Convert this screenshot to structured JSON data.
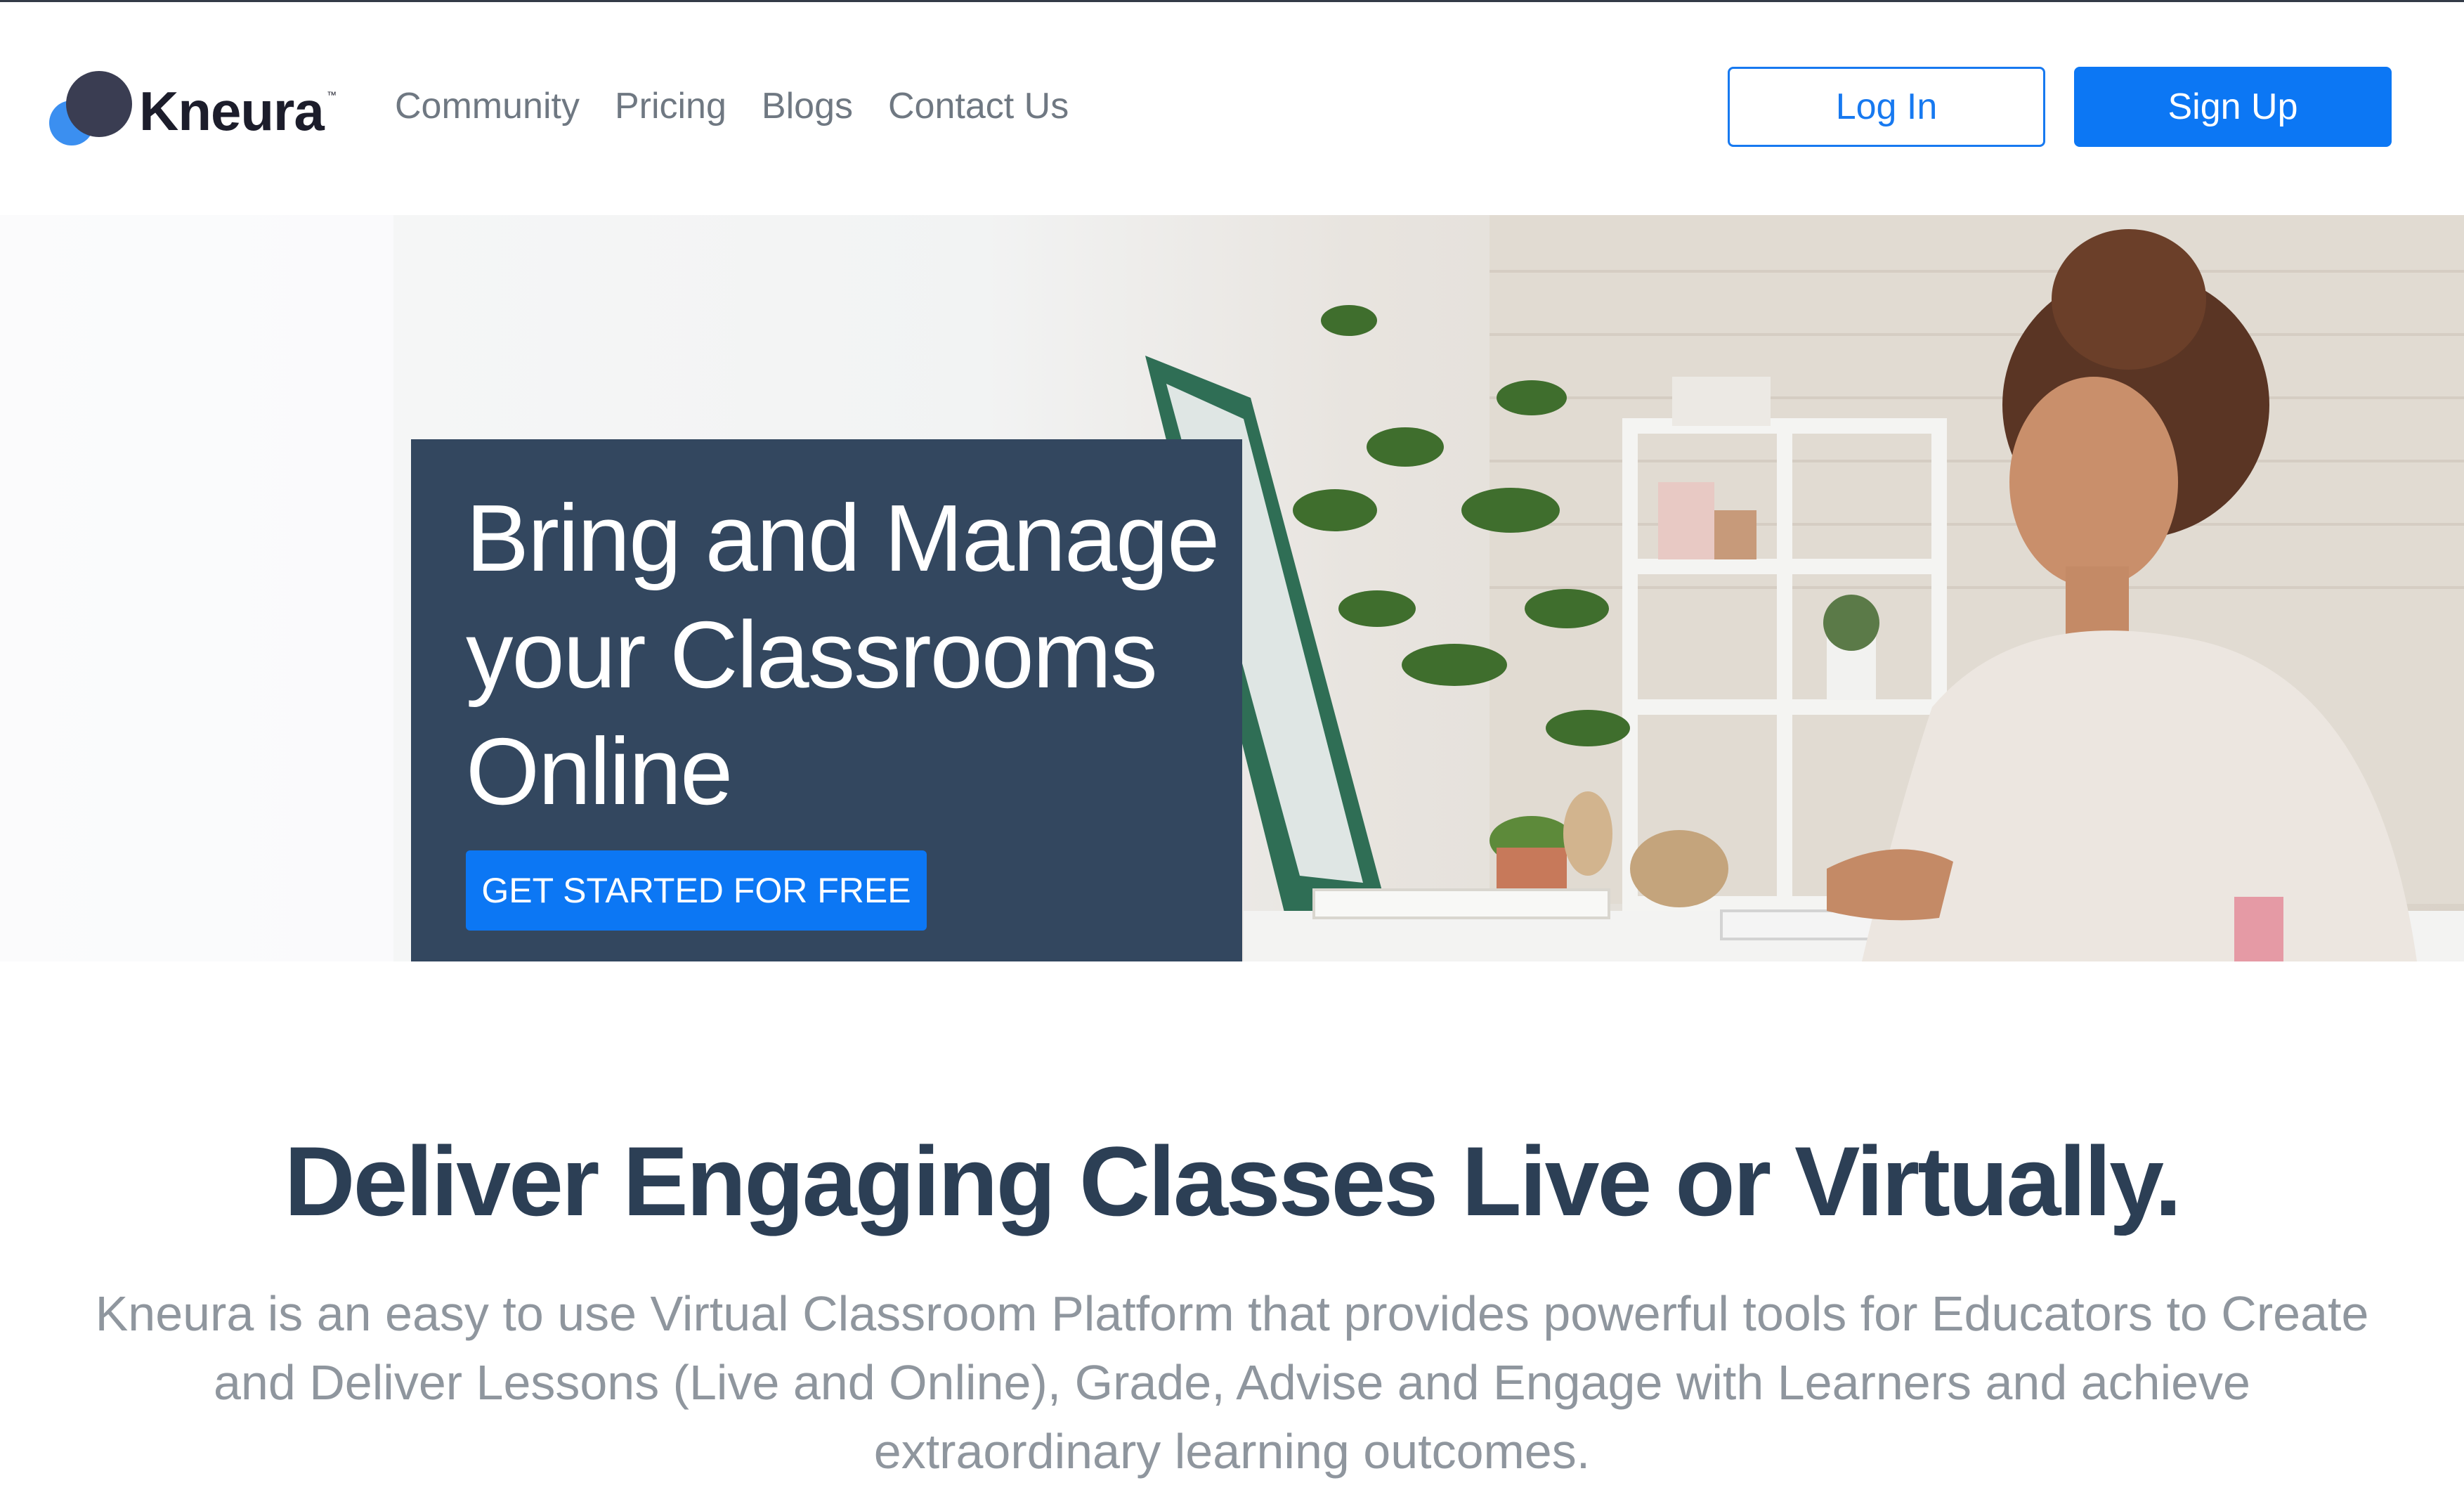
{
  "header": {
    "logo_text": "Kneura",
    "logo_tm": "™",
    "nav": [
      "Community",
      "Pricing",
      "Blogs",
      "Contact Us"
    ],
    "login_label": "Log In",
    "signup_label": "Sign Up"
  },
  "hero": {
    "title_lines": [
      "Bring and Manage",
      "your Classrooms",
      "Online"
    ],
    "cta_label": "GET STARTED FOR FREE"
  },
  "intro": {
    "title": "Deliver Engaging Classes Live or Virtually.",
    "description": "Kneura is an easy to use Virtual Classroom Platform that provides powerful tools for Educators to Create and Deliver Lessons (Live and Online), Grade, Advise and Engage with Learners and achieve extraordinary learning outcomes."
  },
  "colors": {
    "brand_blue": "#0c77f4",
    "hero_card": "#33475f",
    "heading": "#2c3f55",
    "body_text": "#8f969e"
  }
}
